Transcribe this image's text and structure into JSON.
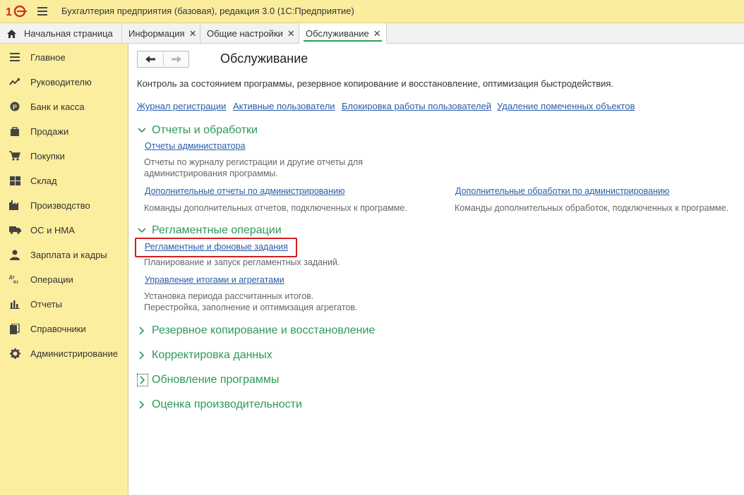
{
  "app": {
    "logo_text": "1С",
    "title": "Бухгалтерия предприятия (базовая), редакция 3.0  (1С:Предприятие)"
  },
  "tabs": [
    {
      "label": "Начальная страница",
      "closable": false,
      "active": false,
      "icon": "home-icon"
    },
    {
      "label": "Информация",
      "closable": true,
      "active": false
    },
    {
      "label": "Общие настройки",
      "closable": true,
      "active": false
    },
    {
      "label": "Обслуживание",
      "closable": true,
      "active": true
    }
  ],
  "tab_close_glyph": "✕",
  "sidebar": {
    "items": [
      {
        "label": "Главное",
        "icon": "list-icon"
      },
      {
        "label": "Руководителю",
        "icon": "trend-icon"
      },
      {
        "label": "Банк и касса",
        "icon": "coin-icon"
      },
      {
        "label": "Продажи",
        "icon": "bag-icon"
      },
      {
        "label": "Покупки",
        "icon": "cart-icon"
      },
      {
        "label": "Склад",
        "icon": "warehouse-icon"
      },
      {
        "label": "Производство",
        "icon": "factory-icon"
      },
      {
        "label": "ОС и НМА",
        "icon": "truck-icon"
      },
      {
        "label": "Зарплата и кадры",
        "icon": "person-icon"
      },
      {
        "label": "Операции",
        "icon": "dt-kt-icon"
      },
      {
        "label": "Отчеты",
        "icon": "bar-chart-icon"
      },
      {
        "label": "Справочники",
        "icon": "books-icon"
      },
      {
        "label": "Администрирование",
        "icon": "gear-icon"
      }
    ]
  },
  "page": {
    "title": "Обслуживание",
    "description": "Контроль за состоянием программы, резервное копирование и восстановление, оптимизация быстродействия.",
    "top_links": [
      "Журнал регистрации",
      "Активные пользователи",
      "Блокировка работы пользователей",
      "Удаление помеченных объектов"
    ]
  },
  "groups": {
    "reports": {
      "title": "Отчеты и обработки",
      "expanded": true,
      "admin_reports_link": "Отчеты администратора",
      "admin_reports_note_1": "Отчеты по журналу регистрации и другие отчеты для",
      "admin_reports_note_2": "администрирования программы.",
      "extra_reports_link": "Дополнительные отчеты по администрированию",
      "extra_reports_note": "Команды дополнительных отчетов, подключенных к программе.",
      "extra_processing_link": "Дополнительные обработки по администрированию",
      "extra_processing_note": "Команды дополнительных обработок, подключенных к программе."
    },
    "routine": {
      "title": "Регламентные операции",
      "expanded": true,
      "jobs_link": "Регламентные и фоновые задания",
      "jobs_note": "Планирование и запуск регламентных заданий.",
      "totals_link": "Управление итогами и агрегатами",
      "totals_note_1": "Установка периода рассчитанных итогов.",
      "totals_note_2": "Перестройка, заполнение и оптимизация агрегатов."
    },
    "backup": {
      "title": "Резервное копирование и восстановление",
      "expanded": false
    },
    "correction": {
      "title": "Корректировка данных",
      "expanded": false
    },
    "update": {
      "title": "Обновление программы",
      "expanded": false
    },
    "performance": {
      "title": "Оценка производительности",
      "expanded": false
    }
  },
  "colors": {
    "titlebar_bg": "#fbed9e",
    "sidebar_bg": "#fbee9f",
    "group_title": "#2c9a57",
    "link": "#2a5ca8",
    "highlight_border": "#d21f1f",
    "active_tab_underline": "#2e9c5d"
  }
}
